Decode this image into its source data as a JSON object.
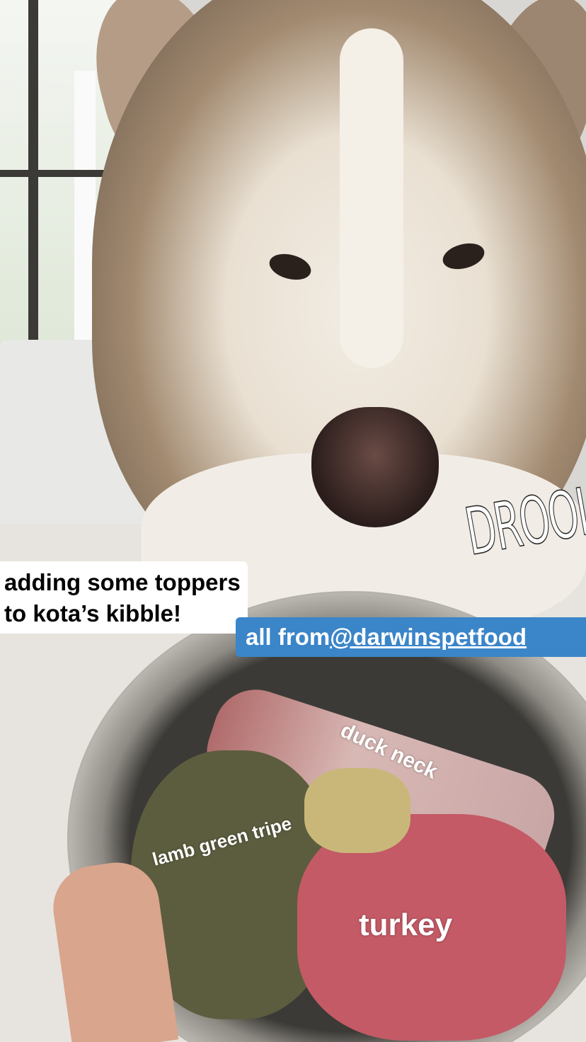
{
  "captions": {
    "line1": "adding some toppers",
    "line2": "to kota’s kibble!",
    "source_prefix": "all from",
    "source_handle": "@darwinspetfood",
    "drool": "DROOL"
  },
  "labels": {
    "duck": "duck neck",
    "tripe": "lamb green tripe",
    "turkey": "turkey"
  },
  "colors": {
    "caption_bg": "#ffffff",
    "mention_bg": "#3b85c9"
  }
}
